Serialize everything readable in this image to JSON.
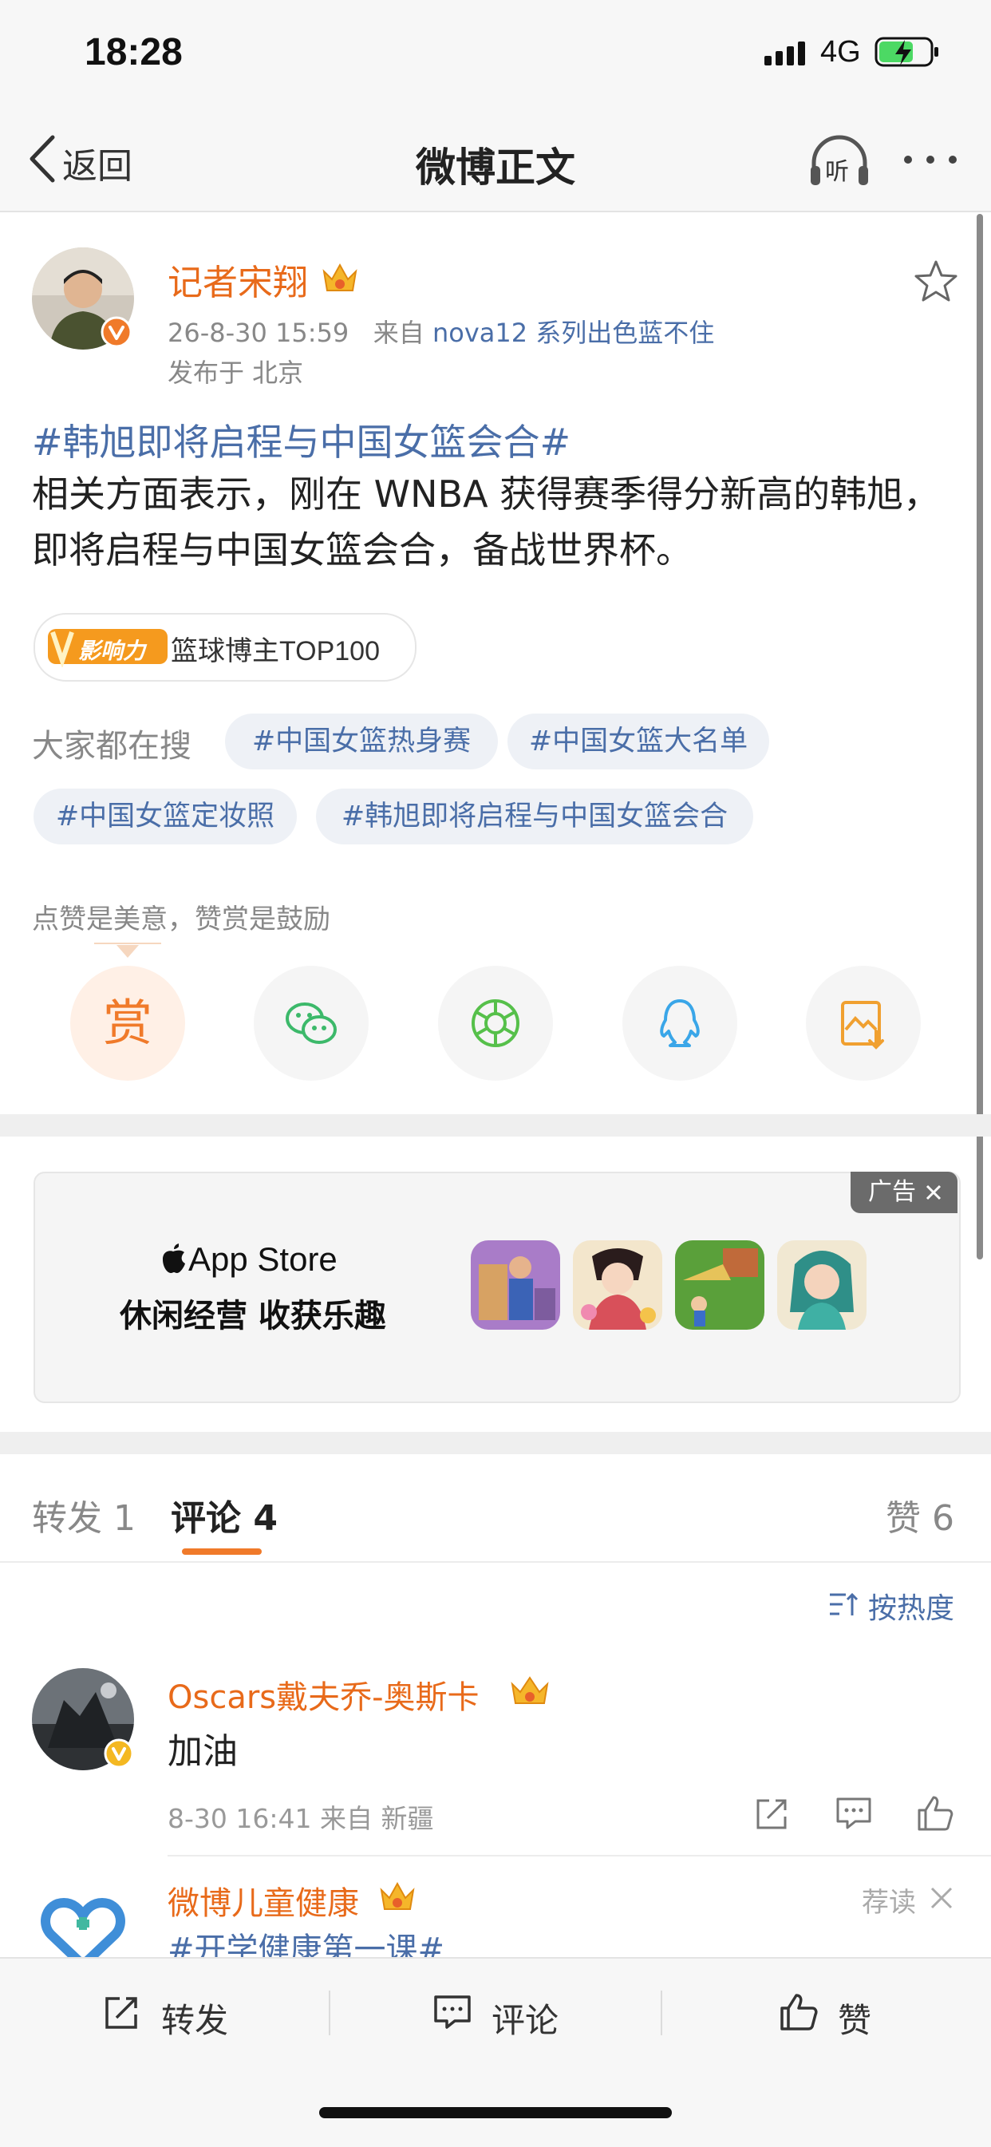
{
  "status_bar": {
    "time": "18:28",
    "network": "4G"
  },
  "nav": {
    "back_label": "返回",
    "title": "微博正文",
    "listen_label": "听"
  },
  "post": {
    "author": "记者宋翔",
    "timestamp": "26-8-30 15:59",
    "source_prefix": "来自",
    "source": "nova12 系列出色蓝不住",
    "location": "发布于 北京",
    "hashtag": "#韩旭即将启程与中国女篮会合#",
    "body": "相关方面表示，刚在 WNBA 获得赛季得分新高的韩旭，即将启程与中国女篮会合，备战世界杯。",
    "influence_badge": "影响力",
    "influence_label": "篮球博主TOP100"
  },
  "trending": {
    "label": "大家都在搜",
    "chips": [
      "#中国女篮热身赛",
      "#中国女篮大名单",
      "#中国女篮定妆照",
      "#韩旭即将启程与中国女篮会合"
    ]
  },
  "reward": {
    "text": "点赞是美意，赞赏是鼓励",
    "button_label": "赏",
    "share_icons": [
      "wechat-icon",
      "moments-icon",
      "qq-icon",
      "save-image-icon"
    ]
  },
  "ad": {
    "tag": "广告",
    "brand": "App Store",
    "slogan": "休闲经营 收获乐趣"
  },
  "tabs": {
    "repost": "转发 1",
    "comments": "评论 4",
    "likes": "赞 6"
  },
  "sort": {
    "label": "按热度"
  },
  "comments": [
    {
      "author": "Oscars戴夫乔-奥斯卡",
      "text": "加油",
      "meta": "8-30 16:41  来自 新疆"
    },
    {
      "author": "微博儿童健康",
      "hashtag": "#开学健康第一课#",
      "tag": "荐读"
    }
  ],
  "bottom_bar": {
    "repost": "转发",
    "comment": "评论",
    "like": "赞"
  },
  "colors": {
    "accent": "#e86a1a",
    "link": "#4a6ea8",
    "orange": "#f07a2a"
  }
}
